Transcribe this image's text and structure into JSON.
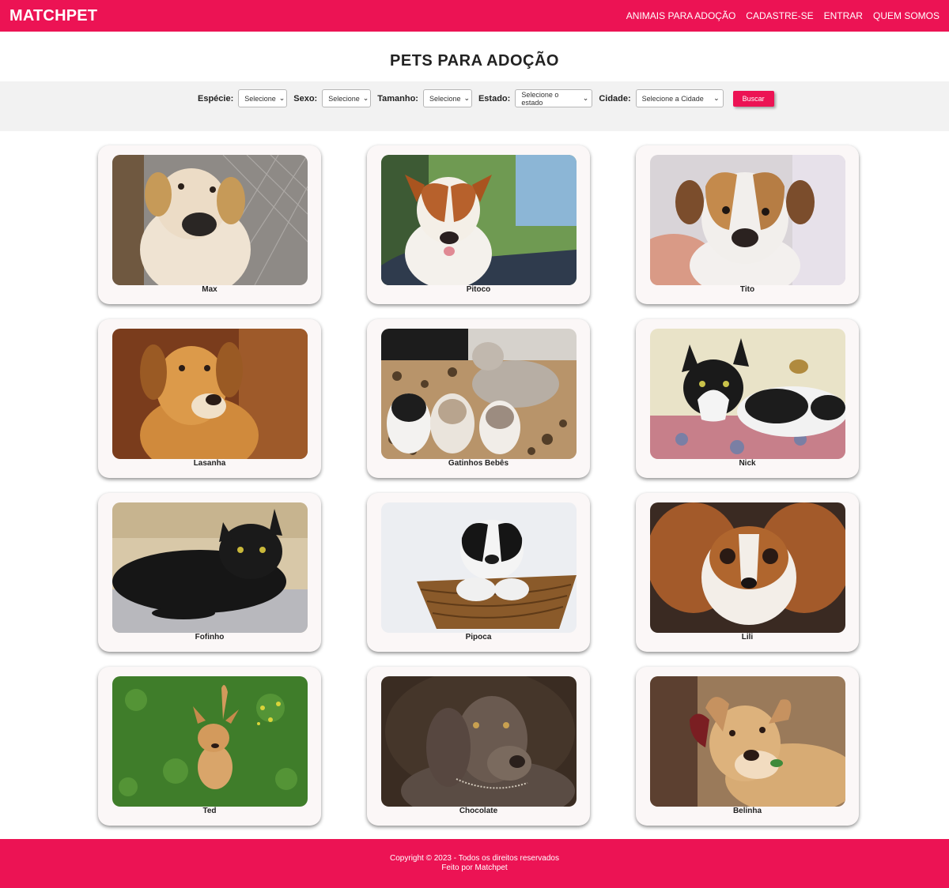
{
  "header": {
    "brand": "MATCHPET",
    "nav": [
      {
        "label": "ANIMAIS PARA ADOÇÃO"
      },
      {
        "label": "CADASTRE-SE"
      },
      {
        "label": "ENTRAR"
      },
      {
        "label": "QUEM SOMOS"
      }
    ]
  },
  "page": {
    "title": "PETS PARA ADOÇÃO"
  },
  "filters": {
    "especie_label": "Espécie:",
    "especie_value": "Selecione",
    "sexo_label": "Sexo:",
    "sexo_value": "Selecione",
    "tamanho_label": "Tamanho:",
    "tamanho_value": "Selecione",
    "estado_label": "Estado:",
    "estado_value": "Selecione o estado",
    "cidade_label": "Cidade:",
    "cidade_value": "Selecione a Cidade",
    "search_button": "Buscar"
  },
  "pets": [
    {
      "name": "Max"
    },
    {
      "name": "Pitoco"
    },
    {
      "name": "Tito"
    },
    {
      "name": "Lasanha"
    },
    {
      "name": "Gatinhos Bebês"
    },
    {
      "name": "Nick"
    },
    {
      "name": "Fofinho"
    },
    {
      "name": "Pipoca"
    },
    {
      "name": "Lili"
    },
    {
      "name": "Ted"
    },
    {
      "name": "Chocolate"
    },
    {
      "name": "Belinha"
    }
  ],
  "footer": {
    "copyright": "Copyright © 2023 - Todos os direitos reservados",
    "made_by": "Feito por Matchpet"
  },
  "colors": {
    "brand": "#ec1354",
    "filter_band": "#f2f2f2",
    "card": "#fbf7f7"
  }
}
